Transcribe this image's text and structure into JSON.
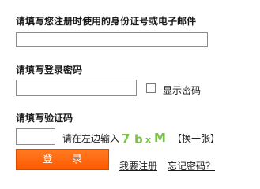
{
  "account": {
    "label": "请填写您注册时使用的身份证号或电子邮件",
    "value": ""
  },
  "password": {
    "label": "请填写登录密码",
    "value": "",
    "show_password_label": "显示密码",
    "show_password_checked": false
  },
  "captcha": {
    "label": "请填写验证码",
    "value": "",
    "hint": "请在左边输入",
    "chars": [
      "7",
      "b",
      "x",
      "M"
    ],
    "color": "#7cc24a",
    "refresh_label": "【换一张】"
  },
  "actions": {
    "login_label": "登 录",
    "register_label": "我要注册",
    "forgot_label": "忘记密码？",
    "login_color": "#ff6410"
  }
}
